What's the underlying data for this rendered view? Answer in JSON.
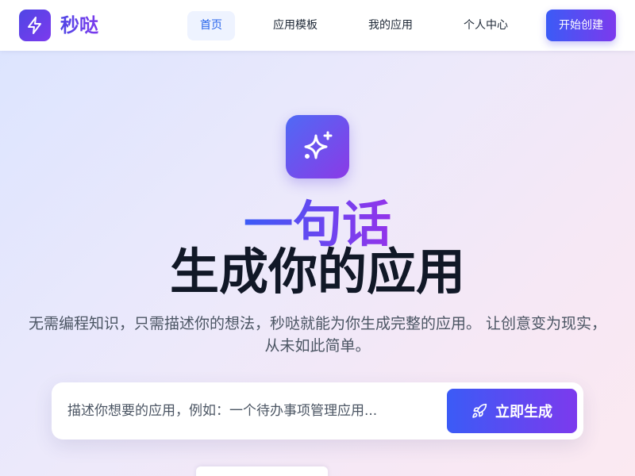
{
  "brand": {
    "name": "秒哒",
    "icon": "lightning-icon"
  },
  "nav": {
    "items": [
      {
        "label": "首页",
        "active": true
      },
      {
        "label": "应用模板",
        "active": false
      },
      {
        "label": "我的应用",
        "active": false
      },
      {
        "label": "个人中心",
        "active": false
      }
    ],
    "cta": "开始创建"
  },
  "hero": {
    "icon": "sparkles-icon",
    "title_line1": "一句话",
    "title_line2": "生成你的应用",
    "description": "无需编程知识，只需描述你的想法，秒哒就能为你生成完整的应用。 让创意变为现实，从未如此简单。"
  },
  "search": {
    "placeholder": "描述你想要的应用，例如：一个待办事项管理应用...",
    "value": "",
    "submit_label": "立即生成",
    "submit_icon": "rocket-icon"
  },
  "colors": {
    "accent": "#4f46e5",
    "accent2": "#7c3aed",
    "active_nav": "#2563eb"
  }
}
